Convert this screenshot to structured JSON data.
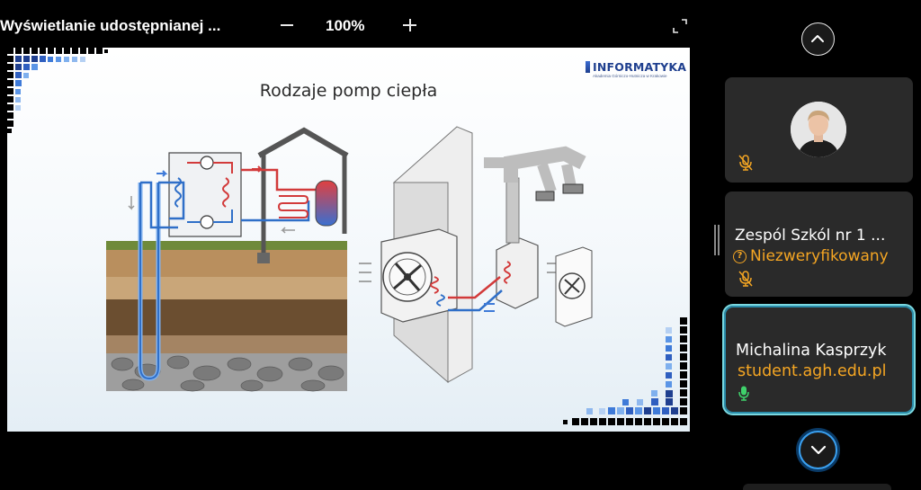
{
  "toolbar": {
    "share_title": "Wyświetlanie udostępnianej ...",
    "zoom_level": "100%"
  },
  "slide": {
    "title": "Rodzaje pomp ciepła",
    "logo_text": "INFORMATYKA",
    "logo_subtitle": "Akademia Górniczo-Hutnicza w Krakowie"
  },
  "participants": [
    {
      "name": "",
      "status": "",
      "mic": "muted",
      "has_avatar": true
    },
    {
      "name": "Zespól Szkól nr 1 ...",
      "status": "Niezweryfikowany",
      "mic": "muted"
    },
    {
      "name": "Michalina Kasprzyk",
      "email": "student.agh.edu.pl",
      "mic": "active",
      "speaking": true
    }
  ],
  "colors": {
    "accent_orange": "#f5a623",
    "speaking_border": "#7ad8e0",
    "mic_active": "#3fd16b",
    "logo_blue": "#1f3f8f"
  },
  "icons": {
    "collapse": "chevron-up-icon",
    "expand": "chevron-down-icon",
    "fullscreen": "expand-icon",
    "mic_muted": "mic-off-icon",
    "mic_active": "mic-icon",
    "unverified": "question-circle-icon"
  }
}
